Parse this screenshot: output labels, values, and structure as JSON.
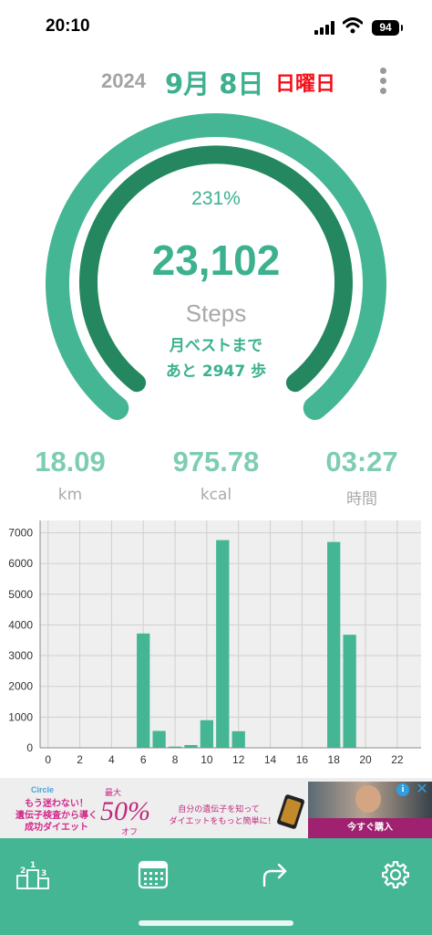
{
  "status_bar": {
    "time": "20:10",
    "battery": "94"
  },
  "header": {
    "year": "2024",
    "month_day": "9月 8日",
    "weekday": "日曜日"
  },
  "gauge": {
    "percent_text": "231%",
    "steps": "23,102",
    "steps_label": "Steps",
    "best_line1": "月ベストまで",
    "best_line2": "あと 2947 歩",
    "colors": {
      "outer": "#44b694",
      "inner": "#24875f"
    }
  },
  "stats": [
    {
      "value": "18.09",
      "unit": "km"
    },
    {
      "value": "975.78",
      "unit": "kcal"
    },
    {
      "value": "03:27",
      "unit": "時間"
    }
  ],
  "chart_data": {
    "type": "bar",
    "x": [
      0,
      1,
      2,
      3,
      4,
      5,
      6,
      7,
      8,
      9,
      10,
      11,
      12,
      13,
      14,
      15,
      16,
      17,
      18,
      19,
      20,
      21,
      22,
      23
    ],
    "values": [
      0,
      0,
      0,
      0,
      0,
      0,
      3720,
      550,
      40,
      90,
      900,
      6760,
      540,
      0,
      0,
      0,
      0,
      0,
      6700,
      3680,
      0,
      0,
      0,
      0
    ],
    "xticks": [
      0,
      2,
      4,
      6,
      8,
      10,
      12,
      14,
      16,
      18,
      20,
      22
    ],
    "yticks": [
      0,
      1000,
      2000,
      3000,
      4000,
      5000,
      6000,
      7000
    ],
    "ylim": [
      0,
      7400
    ],
    "xlim": [
      -0.5,
      23.5
    ],
    "grid": true,
    "bar_color": "#44b694",
    "background": "#efefef"
  },
  "ad": {
    "logo": "Circle",
    "copy_line1": "もう迷わない！",
    "copy_line2": "遺伝子検査から導く",
    "copy_line3": "成功ダイエット",
    "max_label": "最大",
    "percent": "50%",
    "off_label": "オフ",
    "desc_line1": "自分の遺伝子を知って",
    "desc_line2": "ダイエットをもっと簡単に！",
    "cta": "今すぐ購入",
    "info_glyph": "i",
    "close_glyph": "✕"
  },
  "nav": {
    "color": "#44b694",
    "items": [
      {
        "icon": "podium-icon"
      },
      {
        "icon": "calendar-icon"
      },
      {
        "icon": "share-arrow-icon"
      },
      {
        "icon": "gear-icon"
      }
    ]
  }
}
